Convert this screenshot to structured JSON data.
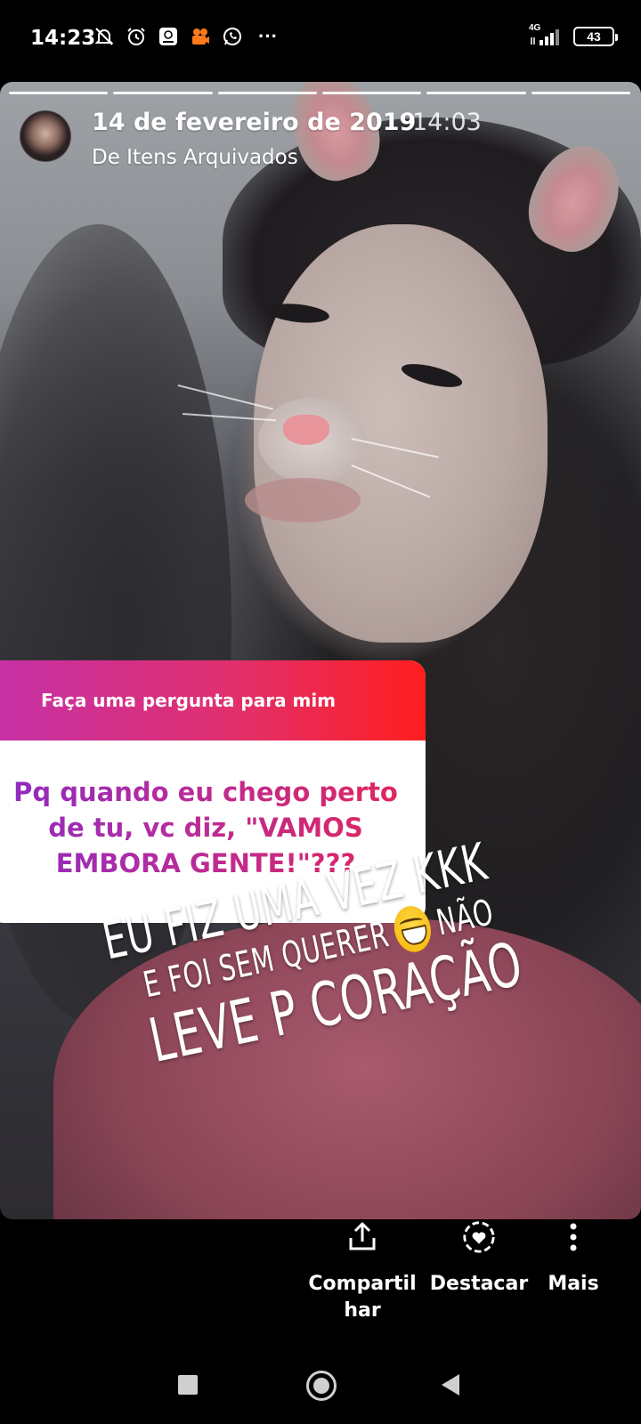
{
  "status_bar": {
    "time": "14:23",
    "network": "4G",
    "battery": "43",
    "more": "···",
    "icons": [
      "do-not-disturb-bell-icon",
      "alarm-icon",
      "news-app-icon",
      "video-app-icon",
      "whatsapp-icon"
    ]
  },
  "story": {
    "segments": 6,
    "date": "14 de fevereiro de 2019",
    "time": "14:03",
    "source": "De Itens Arquivados",
    "question_sticker": {
      "prompt": "Faça uma pergunta para mim",
      "answer": "Pq quando eu chego perto de tu, vc diz, \"VAMOS EMBORA GENTE!\"???"
    },
    "handwritten": {
      "line1": "EU FIZ UMA VEZ KKK",
      "line2a": "E FOI SEM QUERER",
      "emoji": "grinning-face-emoji",
      "line2b": "NÃO",
      "line3": "LEVE P CORAÇÃO"
    }
  },
  "actions": {
    "share": "Compartil har",
    "share_line1": "Compartil",
    "share_line2": "har",
    "highlight": "Destacar",
    "more": "Mais"
  },
  "colors": {
    "sticker_gradient_start": "#c531a8",
    "sticker_gradient_end": "#ff1e1e",
    "shirt": "#8a4556"
  }
}
